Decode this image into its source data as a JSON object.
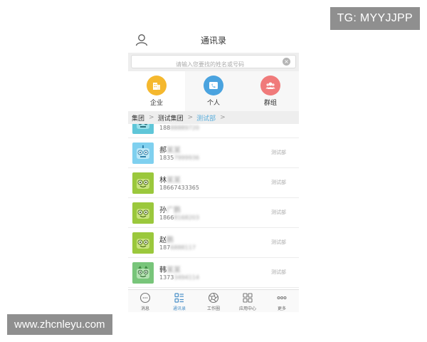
{
  "watermarks": {
    "top_right": "TG: MYYJJPP",
    "bottom_left": "www.zhcnleyu.com"
  },
  "header": {
    "title": "通讯录",
    "left_icon": "user-profile-icon"
  },
  "search": {
    "placeholder": "请输入您要找的姓名或号码",
    "clear_icon": "clear-icon"
  },
  "tabs": [
    {
      "label": "企业",
      "icon": "building-icon",
      "color": "#f5b82e",
      "active": true
    },
    {
      "label": "个人",
      "icon": "phone-card-icon",
      "color": "#4aa3df",
      "active": false
    },
    {
      "label": "群组",
      "icon": "group-icon",
      "color": "#f07a7a",
      "active": false
    }
  ],
  "breadcrumb": {
    "items": [
      "集团",
      "测试集团",
      "测试部"
    ],
    "separator": ">"
  },
  "contacts": [
    {
      "name": "",
      "phone": "188",
      "phone_masked": "88889720",
      "dept": "",
      "avatar": "robot-teal-icon"
    },
    {
      "name": "郝",
      "name_masked": "某某",
      "phone": "1835",
      "phone_masked": "7999936",
      "dept": "测试部",
      "avatar": "robot-blue-icon"
    },
    {
      "name": "林",
      "name_masked": "某某",
      "phone": "18667433365",
      "phone_masked": "",
      "dept": "测试部",
      "avatar": "robot-green-icon"
    },
    {
      "name": "孙",
      "name_masked": "广鹏",
      "phone": "1866",
      "phone_masked": "8168203",
      "dept": "测试部",
      "avatar": "robot-green-icon"
    },
    {
      "name": "赵",
      "name_masked": "鹏",
      "phone": "187",
      "phone_masked": "6888117",
      "dept": "测试部",
      "avatar": "robot-green-icon"
    },
    {
      "name": "韩",
      "name_masked": "某某",
      "phone": "1373",
      "phone_masked": "3494114",
      "dept": "测试部",
      "avatar": "robot-lightgreen-icon"
    }
  ],
  "bottom_nav": [
    {
      "label": "消息",
      "icon": "message-icon",
      "active": false
    },
    {
      "label": "通讯录",
      "icon": "contacts-icon",
      "active": true
    },
    {
      "label": "工作圈",
      "icon": "aperture-icon",
      "active": false
    },
    {
      "label": "应用中心",
      "icon": "apps-grid-icon",
      "active": false
    },
    {
      "label": "更多",
      "icon": "more-icon",
      "active": false
    }
  ],
  "colors": {
    "accent": "#4a90c8",
    "breadcrumb_current": "#5aaedc"
  }
}
